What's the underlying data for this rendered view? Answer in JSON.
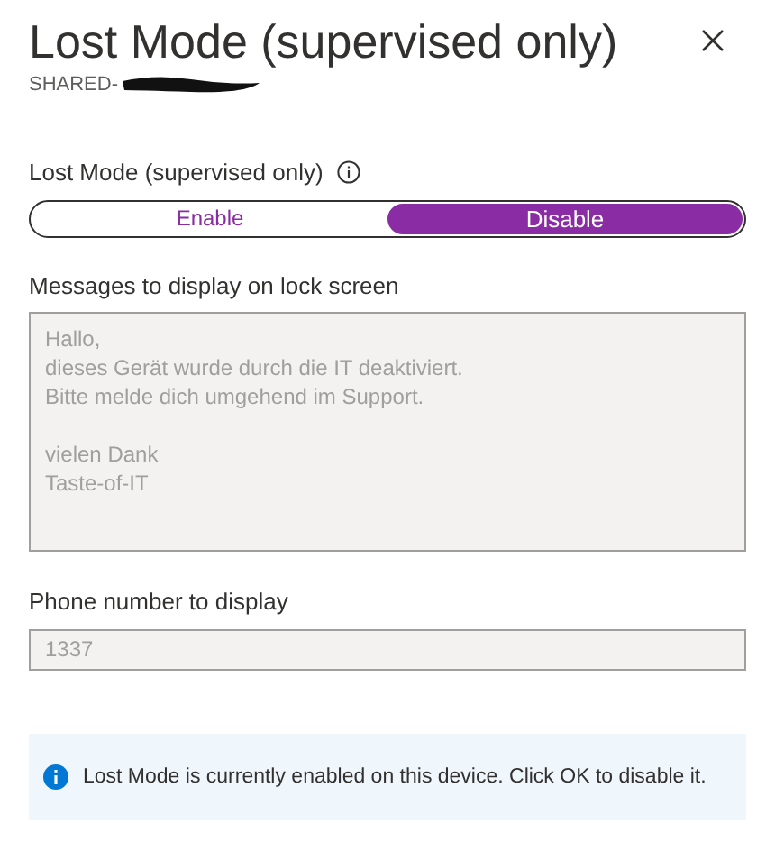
{
  "panel": {
    "title": "Lost Mode (supervised only)",
    "subtitle": "SHARED-"
  },
  "lost_mode": {
    "label": "Lost Mode (supervised only)",
    "options": [
      {
        "label": "Enable",
        "selected": false
      },
      {
        "label": "Disable",
        "selected": true
      }
    ]
  },
  "message": {
    "label": "Messages to display on lock screen",
    "disabled": true,
    "value": "Hallo,\ndieses Gerät wurde durch die IT deaktiviert.\nBitte melde dich umgehend im Support.\n\nvielen Dank\nTaste-of-IT"
  },
  "phone": {
    "label": "Phone number to display",
    "disabled": true,
    "value": "1337"
  },
  "info_bar": {
    "text": "Lost Mode is currently enabled on this device. Click OK to disable it."
  }
}
